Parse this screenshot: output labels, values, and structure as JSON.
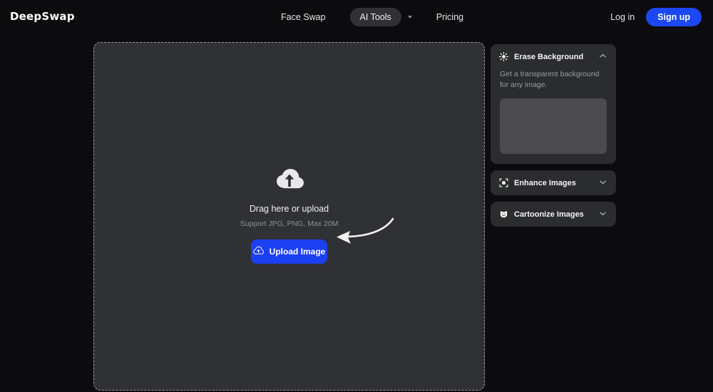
{
  "brand": {
    "logo": "DeepSwap"
  },
  "header": {
    "nav": [
      {
        "label": "Face Swap",
        "icon": "",
        "active": false
      },
      {
        "label": "AI Tools",
        "icon": "chevron-down-icon",
        "active": true
      },
      {
        "label": "Pricing",
        "icon": "",
        "active": false
      }
    ],
    "login_label": "Log in",
    "signup_label": "Sign up"
  },
  "uploader": {
    "icon": "cloud-upload-icon",
    "title": "Drag here or upload",
    "subtitle": "Support JPG, PNG, Max 20M",
    "button_label": "Upload Image",
    "button_icon": "cloud-upload-icon",
    "annotation": "curved-arrow-pointing-left"
  },
  "panel": {
    "cards": [
      {
        "title": "Erase Background",
        "icon": "sparkle-burst-icon",
        "chevron": "chevron-up-icon",
        "expanded": true,
        "description": "Get a transparent background for any image.",
        "preview": "empty-preview-placeholder"
      },
      {
        "title": "Enhance Images",
        "icon": "enhance-frame-icon",
        "chevron": "chevron-down-icon",
        "expanded": false,
        "description": "",
        "preview": ""
      },
      {
        "title": "Cartoonize Images",
        "icon": "cartoon-face-icon",
        "chevron": "chevron-down-icon",
        "expanded": false,
        "description": "",
        "preview": ""
      }
    ]
  },
  "colors": {
    "page_background": "#0c0c0e",
    "accent_blue": "#1c47f2",
    "stage_background": "#2f3134",
    "card_background": "#2a2c2e",
    "preview_background": "#4b4b4d",
    "muted_text": "#9b9da1"
  }
}
